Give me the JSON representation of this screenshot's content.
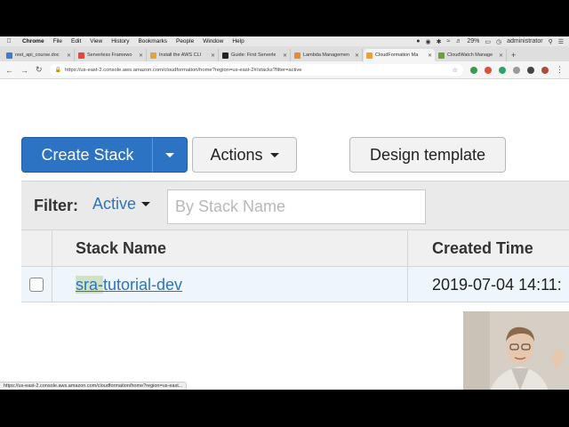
{
  "menubar": {
    "items": [
      "Chrome",
      "File",
      "Edit",
      "View",
      "History",
      "Bookmarks",
      "People",
      "Window",
      "Help"
    ],
    "battery": "29%",
    "user": "administrator"
  },
  "tabs": [
    {
      "label": "rest_api_course.doc",
      "color": "#3b7bd8",
      "active": false
    },
    {
      "label": "Serverless Framewo",
      "color": "#e2483d",
      "active": false
    },
    {
      "label": "Install the AWS CLI",
      "color": "#e6a23c",
      "active": false
    },
    {
      "label": "Guide: First Serverle",
      "color": "#222222",
      "active": false
    },
    {
      "label": "Lambda Managemen",
      "color": "#e98b2a",
      "active": false
    },
    {
      "label": "CloudFormation Ma",
      "color": "#f0a030",
      "active": true
    },
    {
      "label": "CloudWatch Manage",
      "color": "#6aa23a",
      "active": false
    }
  ],
  "address": {
    "url": "https://us-east-2.console.aws.amazon.com/cloudformation/home?region=us-east-2#/stacks?filter=active"
  },
  "toolbar": {
    "create_label": "Create Stack",
    "actions_label": "Actions",
    "design_label": "Design template"
  },
  "filter": {
    "label": "Filter:",
    "value": "Active",
    "placeholder": "By Stack Name"
  },
  "table": {
    "columns": [
      "Stack Name",
      "Created Time"
    ],
    "rows": [
      {
        "stack_prefix": "sra-",
        "stack_rest": "tutorial-dev",
        "created": "2019-07-04 14:11:"
      }
    ]
  },
  "status_url": "https://us-east-2.console.aws.amazon.com/cloudformation/home?region=us-east..."
}
